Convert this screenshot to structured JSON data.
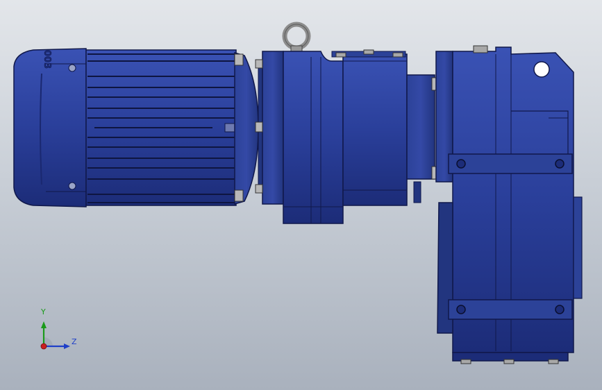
{
  "viewport": {
    "background_top": "#e3e6ea",
    "background_bottom": "#a9b1bd"
  },
  "model": {
    "body_color": "#2a3f9a",
    "body_dark_color": "#1c2c78",
    "body_light_color": "#3a52b4",
    "hardware_color": "#b8b8b8",
    "components": [
      "motor-fan-cover",
      "motor-housing",
      "adapter-flange",
      "lifting-eye",
      "helical-reducer-stage",
      "parallel-shaft-gearbox"
    ]
  },
  "triad": {
    "y_label": "Y",
    "z_label": "Z",
    "y_color": "#1a9a1a",
    "z_color": "#1f3fc8",
    "x_color": "#c81f1f"
  }
}
